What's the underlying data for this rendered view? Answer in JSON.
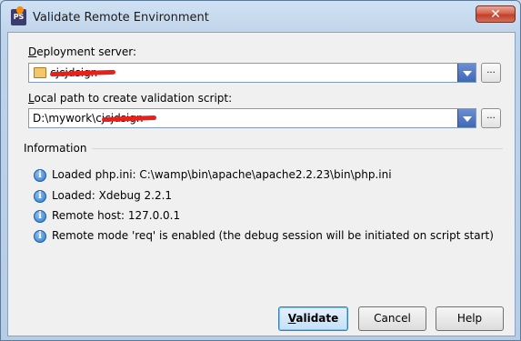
{
  "window": {
    "title": "Validate Remote Environment",
    "close_symbol": "✕"
  },
  "deployment": {
    "label_mnemonic": "D",
    "label_rest": "eployment server:",
    "value": "cjcjdsign",
    "browse_label": "..."
  },
  "local_path": {
    "label_mnemonic": "L",
    "label_rest": "ocal path to create validation script:",
    "value": "D:\\mywork\\cjcjdsign",
    "browse_label": "..."
  },
  "information": {
    "title": "Information",
    "items": [
      "Loaded php.ini: C:\\wamp\\bin\\apache\\apache2.2.23\\bin\\php.ini",
      "Loaded: Xdebug 2.2.1",
      "Remote host: 127.0.0.1",
      "Remote mode 'req' is enabled (the debug session will be initiated on script start)"
    ]
  },
  "buttons": {
    "validate_mnemonic": "V",
    "validate_rest": "alidate",
    "cancel": "Cancel",
    "help": "Help"
  }
}
